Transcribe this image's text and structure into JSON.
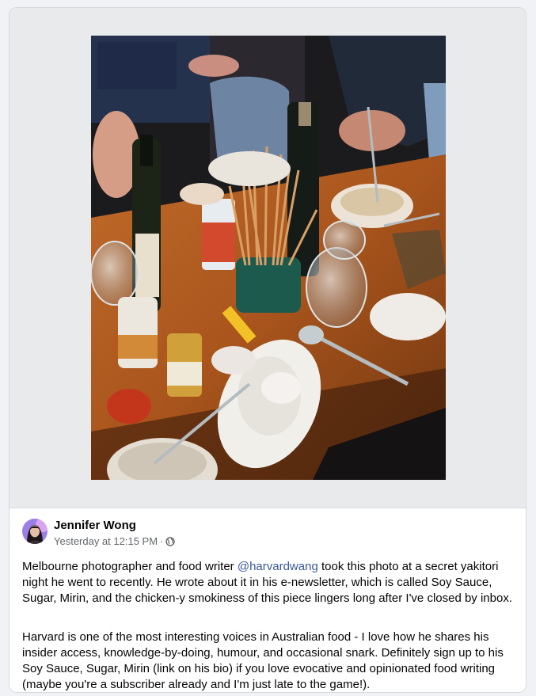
{
  "post": {
    "author": "Jennifer Wong",
    "timestamp": "Yesterday at 12:15 PM",
    "meta_separator": "·",
    "audience_icon": "globe-icon",
    "paragraph1": {
      "before": "Melbourne photographer and food writer ",
      "mention": "@harvardwang",
      "after": " took this photo at a secret yakitori night he went to recently. He wrote about it in his e-newsletter, which is called Soy Sauce, Sugar, Mirin, and the chicken-y smokiness of this piece lingers long after I've closed by inbox."
    },
    "paragraph2": "Harvard is one of the most interesting voices in Australian food - I love how he shares his insider access, knowledge-by-doing, humour, and occasional snark. Definitely sign up to his Soy Sauce, Sugar, Mirin (link on his bio) if you love evocative and opinionated food writing (maybe you're a subscriber already and I'm just late to the game!)."
  },
  "colors": {
    "mention": "#385898",
    "meta_text": "#65676b",
    "media_background": "#e9eaec"
  }
}
